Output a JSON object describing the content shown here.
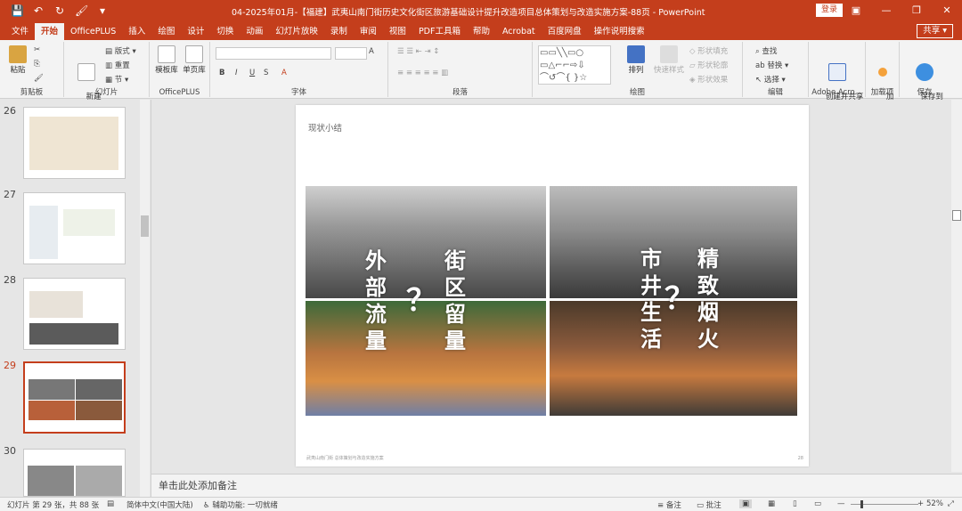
{
  "window": {
    "title": "04-2025年01月-【福建】武夷山南门街历史文化街区旅游基础设计提升改造项目总体策划与改造实施方案-88页  -  PowerPoint",
    "login_label": "登录",
    "controls": [
      "minimize",
      "maximize",
      "close"
    ]
  },
  "tabs": [
    "文件",
    "开始",
    "OfficePLUS",
    "插入",
    "绘图",
    "设计",
    "切换",
    "动画",
    "幻灯片放映",
    "录制",
    "审阅",
    "视图",
    "PDF工具箱",
    "帮助",
    "Acrobat",
    "百度网盘",
    "操作说明搜索"
  ],
  "active_tab": "开始",
  "share_label": "共享",
  "ribbon": {
    "clipboard": {
      "paste": "粘贴",
      "label": "剪贴板"
    },
    "slides": {
      "new_slide": "新建\n幻灯片",
      "layout": "版式",
      "reset": "重置",
      "section": "节",
      "label": "幻灯片"
    },
    "officeplus": {
      "template": "模板库",
      "single": "单页库",
      "label": "OfficePLUS"
    },
    "font": {
      "bold": "B",
      "italic": "I",
      "underline": "U",
      "strike": "S",
      "label": "字体"
    },
    "paragraph": {
      "label": "段落"
    },
    "drawing": {
      "arrange": "排列",
      "quick_styles": "快速样式",
      "fill": "形状填充",
      "outline": "形状轮廓",
      "effect": "形状效果",
      "label": "绘图"
    },
    "editing": {
      "find": "查找",
      "replace": "替换",
      "select": "选择",
      "label": "编辑"
    },
    "adobe": {
      "create_share": "创建并共享\nAdobe PDF",
      "label": "Adobe Acro..."
    },
    "addins": {
      "addins": "加\n载项",
      "label": "加载项"
    },
    "save": {
      "save_baidu": "保存到\n百度网盘",
      "label": "保存"
    }
  },
  "thumbnails": [
    {
      "num": "26",
      "active": false
    },
    {
      "num": "27",
      "active": false
    },
    {
      "num": "28",
      "active": false
    },
    {
      "num": "29",
      "active": true
    },
    {
      "num": "30",
      "active": false
    }
  ],
  "slide": {
    "title": "现状小结",
    "left_text_1": "外部流量",
    "left_text_2": "街区留量",
    "right_text_1": "市井生活",
    "right_text_2": "精致烟火",
    "question": "？",
    "footer": "武夷山南门街 总体策划与改造实施方案",
    "page_no": "28"
  },
  "notes_placeholder": "单击此处添加备注",
  "status": {
    "slide_count": "幻灯片 第 29 张，共 88 张",
    "language": "简体中文(中国大陆)",
    "accessibility": "辅助功能: 一切就绪",
    "notes": "备注",
    "comments": "批注",
    "zoom": "52%"
  },
  "colors": {
    "accent": "#c43e1c"
  }
}
